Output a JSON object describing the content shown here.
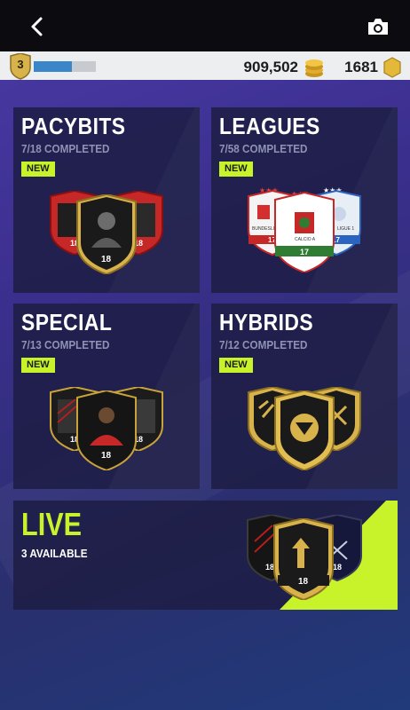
{
  "header": {
    "back_icon": "chevron-left-icon",
    "camera_icon": "camera-icon"
  },
  "status": {
    "level": "3",
    "xp_progress": 0.62,
    "coins": "909,502",
    "points": "1681"
  },
  "tiles": [
    {
      "title": "PACYBITS",
      "subtitle": "7/18 COMPLETED",
      "badge": "NEW"
    },
    {
      "title": "LEAGUES",
      "subtitle": "7/58 COMPLETED",
      "badge": "NEW"
    },
    {
      "title": "SPECIAL",
      "subtitle": "7/13 COMPLETED",
      "badge": "NEW"
    },
    {
      "title": "HYBRIDS",
      "subtitle": "7/12 COMPLETED",
      "badge": "NEW"
    }
  ],
  "live": {
    "title": "LIVE",
    "subtitle": "3 AVAILABLE"
  },
  "card_labels": {
    "rating": "18",
    "league_rating": "17",
    "league_name_left": "BUNDESLIGA",
    "league_name_center": "CALCIO A",
    "league_name_right": "LIGUE 1"
  },
  "colors": {
    "accent": "#c8f32a",
    "gold": "#d8b24a",
    "red": "#c62828",
    "xp_blue": "#3a86c8"
  }
}
